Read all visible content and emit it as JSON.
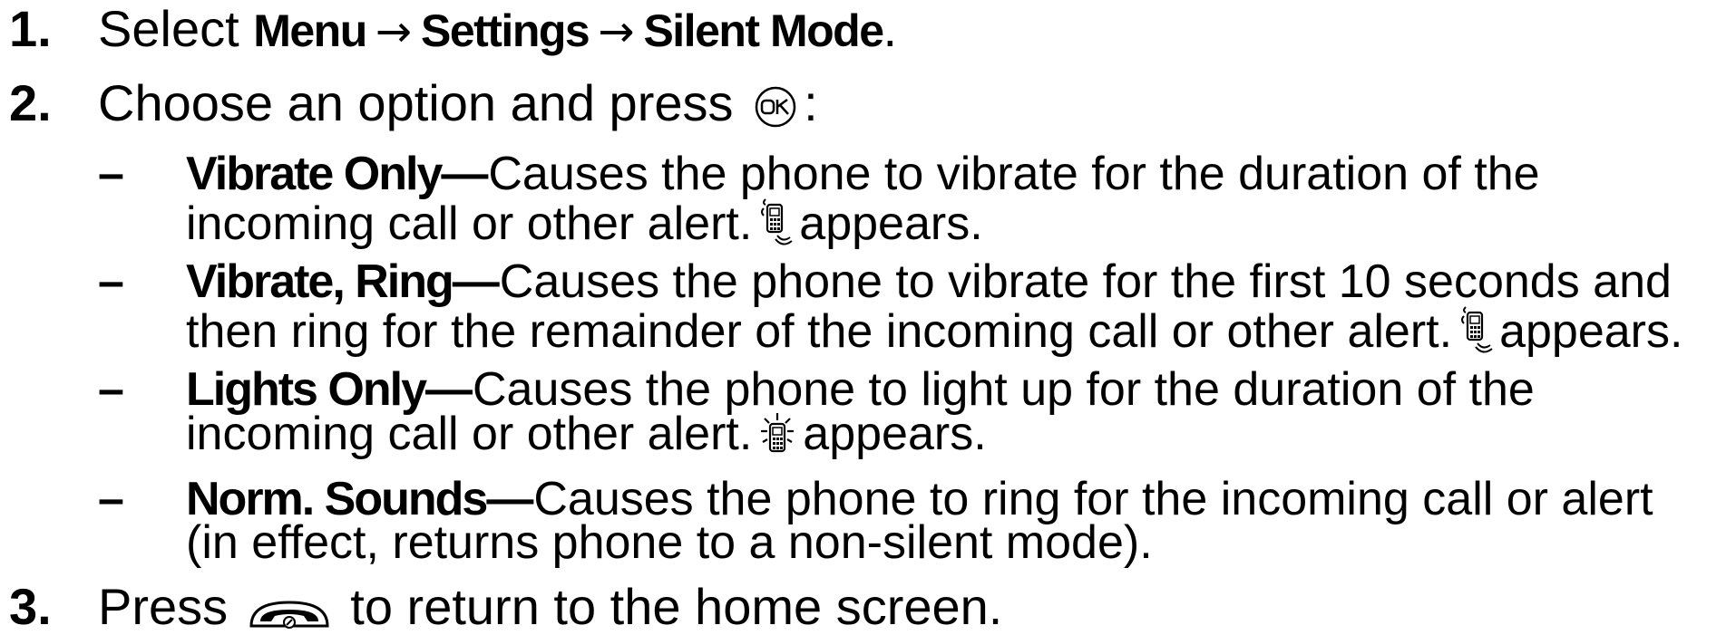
{
  "steps": [
    {
      "number": "1.",
      "prefix": "Select ",
      "menu_path": [
        "Menu",
        "Settings",
        "Silent Mode"
      ],
      "arrow": "→",
      "suffix": "."
    },
    {
      "number": "2.",
      "text": "Choose an option and press",
      "after_icon": ":",
      "icon": "ok-key-icon"
    },
    {
      "number": "3.",
      "text_before": "Press",
      "icon": "end-call-key-icon",
      "text_after": "to return to the home screen."
    }
  ],
  "options": [
    {
      "dash": "–",
      "name": "Vibrate Only",
      "emdash": "—",
      "line1": "Causes the phone to vibrate for the duration of the",
      "line2_before": "incoming call or other alert.",
      "icon": "vibrate-phone-icon",
      "line2_after": "appears."
    },
    {
      "dash": "–",
      "name": "Vibrate, Ring",
      "emdash": "—",
      "line1": "Causes the phone to vibrate for the first 10 seconds and",
      "line2_before": "then ring for the remainder of the incoming call or other alert.",
      "icon": "vibrate-ring-phone-icon",
      "line2_after": "appears."
    },
    {
      "dash": "–",
      "name": "Lights Only",
      "emdash": "—",
      "line1": "Causes the phone to light up for the duration of the",
      "line2_before": "incoming call or other alert.",
      "icon": "lights-phone-icon",
      "line2_after": "appears."
    },
    {
      "dash": "–",
      "name": "Norm. Sounds",
      "emdash": "—",
      "line1": "Causes the phone to ring for the incoming call or alert",
      "line2": "(in effect, returns phone to a non-silent mode)."
    }
  ]
}
